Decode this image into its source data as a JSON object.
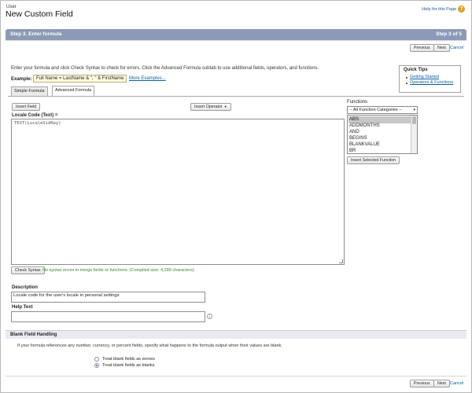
{
  "header": {
    "object_label": "User",
    "title": "New Custom Field",
    "help_link": "Help for this Page",
    "help_icon": "help-icon"
  },
  "step_bar": {
    "title": "Step 3. Enter formula",
    "count": "Step 3 of 5"
  },
  "nav": {
    "previous": "Previous",
    "next": "Next",
    "cancel": "Cancel"
  },
  "instructions": "Enter your formula and click Check Syntax to check for errors. Click the Advanced Formula subtab to use additional fields, operators, and functions.",
  "example": {
    "label": "Example:",
    "code": "Full Name = LastName & \", \" & FirstName",
    "more_link": "More Examples..."
  },
  "quick_tips": {
    "title": "Quick Tips",
    "links": [
      "Getting Started",
      "Operators & Functions"
    ]
  },
  "tabs": [
    "Simple Formula",
    "Advanced Formula"
  ],
  "active_tab": "Advanced Formula",
  "editor": {
    "insert_field": "Insert Field",
    "insert_operator": "Insert Operator",
    "label": "Locale Code (Text) =",
    "formula": "TEXT(LocaleSidKey)"
  },
  "functions": {
    "label": "Functions",
    "category": "-- All Function Categories --",
    "items": [
      "ABS",
      "ADDMONTHS",
      "AND",
      "BEGINS",
      "BLANKVALUE",
      "BR"
    ],
    "selected": "ABS",
    "insert_button": "Insert Selected Function"
  },
  "syntax": {
    "button": "Check Syntax",
    "message": "No syntax errors in merge fields or functions. (Compiled size: 4,289 characters)"
  },
  "description": {
    "label": "Description",
    "value": "Locale code for the user's locale in personal settings"
  },
  "help_text": {
    "label": "Help Text",
    "value": ""
  },
  "blank_handling": {
    "title": "Blank Field Handling",
    "description": "If your formula references any number, currency, or percent fields, specify what happens to the formula output when their values are blank.",
    "options": [
      "Treat blank fields as zeroes",
      "Treat blank fields as blanks"
    ],
    "selected": "Treat blank fields as blanks"
  }
}
